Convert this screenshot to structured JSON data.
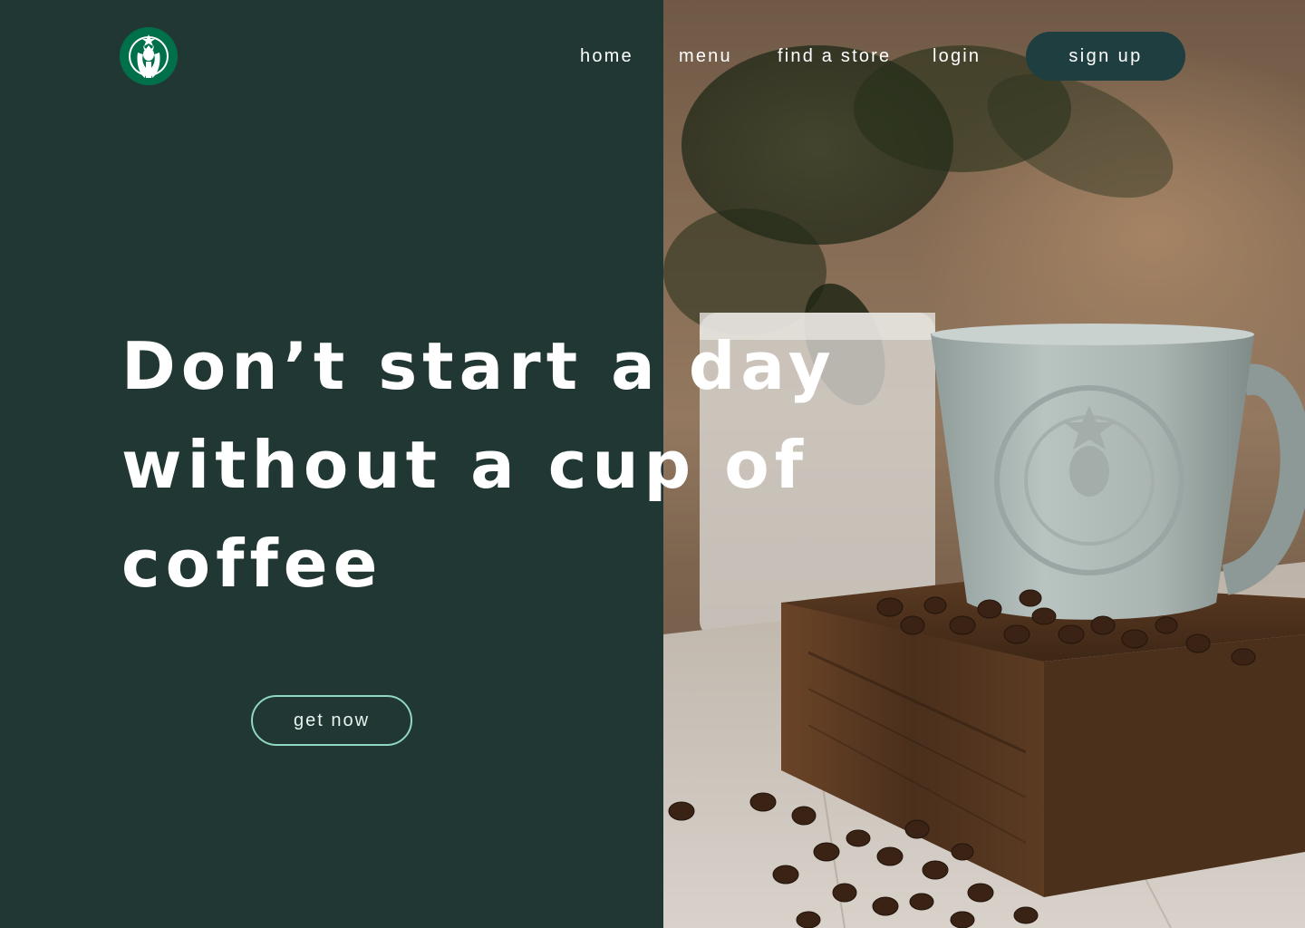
{
  "brand": {
    "logo_icon": "starbucks-siren-logo-icon",
    "logo_color": "#00704A"
  },
  "nav": {
    "items": [
      {
        "label": "home"
      },
      {
        "label": "menu"
      },
      {
        "label": "find a store"
      },
      {
        "label": "login"
      }
    ],
    "signup_label": "sign up",
    "signup_color": "#1e3e3f"
  },
  "hero": {
    "headline_lines": [
      "Don’t start a day",
      "without a cup of",
      "coffee"
    ],
    "cta_label": "get now",
    "cta_border_color": "#8fd7c0",
    "background_color": "#203733"
  },
  "photo": {
    "icon": "coffee-mug-beans-photo"
  }
}
